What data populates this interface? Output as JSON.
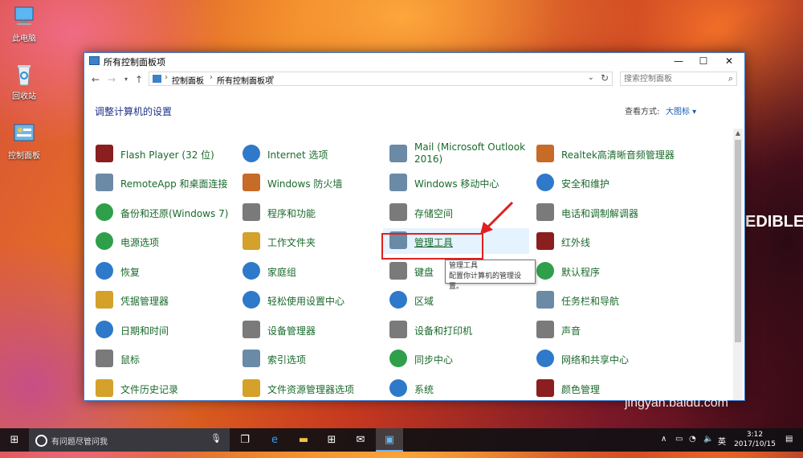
{
  "desktop": {
    "icons": [
      {
        "label": "此电脑",
        "icon": "computer-icon"
      },
      {
        "label": "回收站",
        "icon": "recycle-bin-icon"
      },
      {
        "label": "控制面板",
        "icon": "control-panel-icon"
      }
    ],
    "bg_text": "EDIBLE"
  },
  "window": {
    "title": "所有控制面板项",
    "controls": {
      "minimize": "—",
      "maximize": "☐",
      "close": "✕"
    },
    "breadcrumb": [
      "控制面板",
      "所有控制面板项"
    ],
    "search_placeholder": "搜索控制面板",
    "page_title": "调整计算机的设置",
    "view_label": "查看方式:",
    "view_value": "大图标 ▾",
    "items": [
      {
        "label": "Flash Player (32 位)",
        "icon": "flash-icon"
      },
      {
        "label": "Internet 选项",
        "icon": "internet-options-icon"
      },
      {
        "label": "Mail (Microsoft Outlook 2016)",
        "icon": "mail-icon"
      },
      {
        "label": "Realtek高清晰音频管理器",
        "icon": "speaker-icon"
      },
      {
        "label": "RemoteApp 和桌面连接",
        "icon": "remoteapp-icon"
      },
      {
        "label": "Windows 防火墙",
        "icon": "firewall-icon"
      },
      {
        "label": "Windows 移动中心",
        "icon": "mobility-center-icon"
      },
      {
        "label": "安全和维护",
        "icon": "flag-icon"
      },
      {
        "label": "备份和还原(Windows 7)",
        "icon": "backup-icon"
      },
      {
        "label": "程序和功能",
        "icon": "programs-icon"
      },
      {
        "label": "存储空间",
        "icon": "storage-icon"
      },
      {
        "label": "电话和调制解调器",
        "icon": "phone-icon"
      },
      {
        "label": "电源选项",
        "icon": "power-icon"
      },
      {
        "label": "工作文件夹",
        "icon": "folder-icon"
      },
      {
        "label": "管理工具",
        "icon": "admin-tools-icon"
      },
      {
        "label": "红外线",
        "icon": "infrared-icon"
      },
      {
        "label": "恢复",
        "icon": "recovery-icon"
      },
      {
        "label": "家庭组",
        "icon": "homegroup-icon"
      },
      {
        "label": "键盘",
        "icon": "keyboard-icon"
      },
      {
        "label": "默认程序",
        "icon": "default-programs-icon"
      },
      {
        "label": "凭据管理器",
        "icon": "credential-icon"
      },
      {
        "label": "轻松使用设置中心",
        "icon": "ease-of-access-icon"
      },
      {
        "label": "区域",
        "icon": "region-icon"
      },
      {
        "label": "任务栏和导航",
        "icon": "taskbar-icon"
      },
      {
        "label": "日期和时间",
        "icon": "clock-icon"
      },
      {
        "label": "设备管理器",
        "icon": "device-manager-icon"
      },
      {
        "label": "设备和打印机",
        "icon": "printer-icon"
      },
      {
        "label": "声音",
        "icon": "sound-icon"
      },
      {
        "label": "鼠标",
        "icon": "mouse-icon"
      },
      {
        "label": "索引选项",
        "icon": "index-icon"
      },
      {
        "label": "同步中心",
        "icon": "sync-icon"
      },
      {
        "label": "网络和共享中心",
        "icon": "network-icon"
      },
      {
        "label": "文件历史记录",
        "icon": "file-history-icon"
      },
      {
        "label": "文件资源管理器选项",
        "icon": "explorer-options-icon"
      },
      {
        "label": "系统",
        "icon": "system-icon"
      },
      {
        "label": "颜色管理",
        "icon": "color-icon"
      }
    ],
    "tooltip": {
      "title": "管理工具",
      "desc": "配置你计算机的管理设置。"
    }
  },
  "taskbar": {
    "search_placeholder": "有问题尽管问我",
    "ime": "英",
    "time": "3:12",
    "date": "2017/10/15"
  },
  "watermark": {
    "main": "Bai 经验",
    "sub": "jingyan.baidu.com"
  }
}
